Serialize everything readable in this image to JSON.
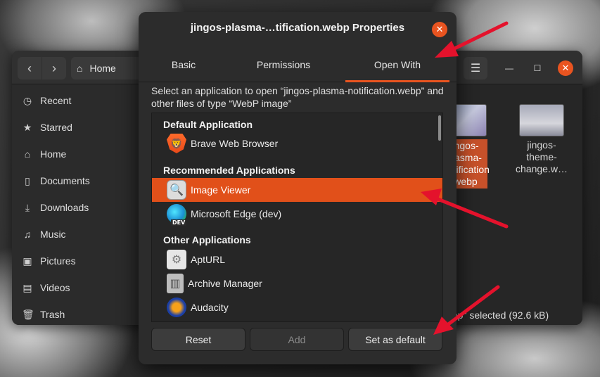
{
  "file_manager": {
    "path_label": "Home",
    "sidebar": [
      {
        "label": "Recent",
        "icon": "clock-icon"
      },
      {
        "label": "Starred",
        "icon": "star-icon"
      },
      {
        "label": "Home",
        "icon": "home-icon"
      },
      {
        "label": "Documents",
        "icon": "document-icon"
      },
      {
        "label": "Downloads",
        "icon": "download-icon"
      },
      {
        "label": "Music",
        "icon": "music-icon"
      },
      {
        "label": "Pictures",
        "icon": "picture-icon"
      },
      {
        "label": "Videos",
        "icon": "video-icon"
      },
      {
        "label": "Trash",
        "icon": "trash-icon"
      }
    ],
    "files": [
      {
        "line1": "jingos-",
        "line2": "plasma-",
        "line3": "notification",
        "line4": ".webp"
      },
      {
        "line1": "jingos-",
        "line2": "theme-",
        "line3": "change.w…"
      }
    ],
    "status": "webp\" selected  (92.6 kB)"
  },
  "dialog": {
    "title": "jingos-plasma-…tification.webp Properties",
    "tabs": {
      "basic": "Basic",
      "permissions": "Permissions",
      "open_with": "Open With"
    },
    "description": "Select an application to open “jingos-plasma-notification.webp” and other files of type “WebP image”",
    "sections": {
      "default": "Default Application",
      "recommended": "Recommended Applications",
      "other": "Other Applications"
    },
    "apps": {
      "brave": "Brave Web Browser",
      "image_viewer": "Image Viewer",
      "edge": "Microsoft Edge (dev)",
      "edge_badge": "DEV",
      "apturl": "AptURL",
      "archive": "Archive Manager",
      "audacity": "Audacity"
    },
    "buttons": {
      "reset": "Reset",
      "add": "Add",
      "set_default": "Set as default"
    }
  },
  "colors": {
    "accent": "#e95420",
    "selected_row": "#e1501a",
    "annotation_arrow": "#e4122c"
  }
}
